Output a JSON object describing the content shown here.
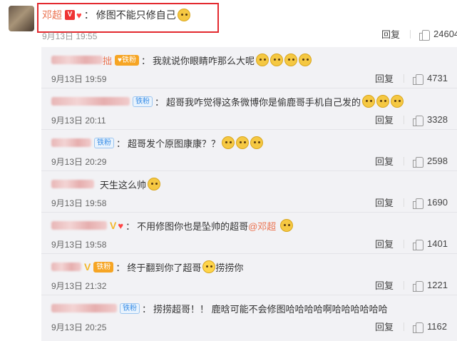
{
  "comment": {
    "author": "邓超",
    "text": "修图不能只修自己",
    "time": "9月13日 19:55",
    "reply_label": "回复",
    "likes": "24604"
  },
  "replies": [
    {
      "name_visible": "拙",
      "text": "我就说你眼睛咋那么大呢",
      "time": "9月13日 19:59",
      "reply_label": "回复",
      "likes": "4731"
    },
    {
      "fan_badge": "铁粉",
      "text": "超哥我咋觉得这条微博你是偷鹿哥手机自己发的",
      "time": "9月13日 20:11",
      "reply_label": "回复",
      "likes": "3328"
    },
    {
      "fan_badge": "铁粉",
      "text": "超哥发个原图康康？？",
      "time": "9月13日 20:29",
      "reply_label": "回复",
      "likes": "2598"
    },
    {
      "text": "天生这么帅",
      "time": "9月13日 19:58",
      "reply_label": "回复",
      "likes": "1690"
    },
    {
      "text": "不用修图你也是坠帅的超哥",
      "mention": "@邓超",
      "time": "9月13日 19:58",
      "reply_label": "回复",
      "likes": "1401"
    },
    {
      "fan_badge": "铁粉",
      "text": "终于翻到你了超哥",
      "text_after": "捞捞你",
      "time": "9月13日 21:32",
      "reply_label": "回复",
      "likes": "1221"
    },
    {
      "fan_badge": "铁粉",
      "text": "捞捞超哥！！ 鹿晗可能不会修图哈哈哈哈啊哈哈哈哈哈哈",
      "time": "9月13日 20:25",
      "reply_label": "回复",
      "likes": "1162"
    }
  ]
}
